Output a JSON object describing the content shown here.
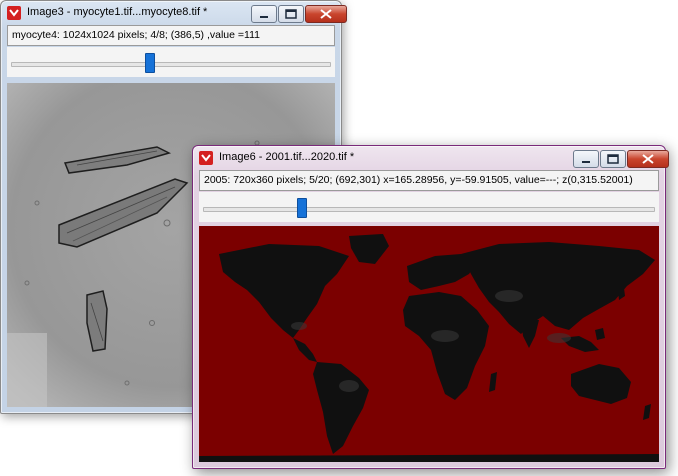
{
  "window1": {
    "title": "Image3 - myocyte1.tif...myocyte8.tif *",
    "info": "myocyte4: 1024x1024 pixels; 4/8; (386,5) ,value =111",
    "slice_position": 0.5,
    "image_content": "grayscale-microscopy-myocytes"
  },
  "window2": {
    "title": "Image6 - 2001.tif...2020.tif *",
    "info": "2005: 720x360 pixels; 5/20; (692,301) x=165.28956, y=-59.91505, value=---; z(0,315.52001)",
    "slice_position": 0.21,
    "image_content": "world-map-dark-red-background"
  },
  "colors": {
    "map_background": "#7b0000",
    "land": "#0f0f0f",
    "slider_thumb": "#1672d8",
    "close_button": "#c9452d"
  }
}
